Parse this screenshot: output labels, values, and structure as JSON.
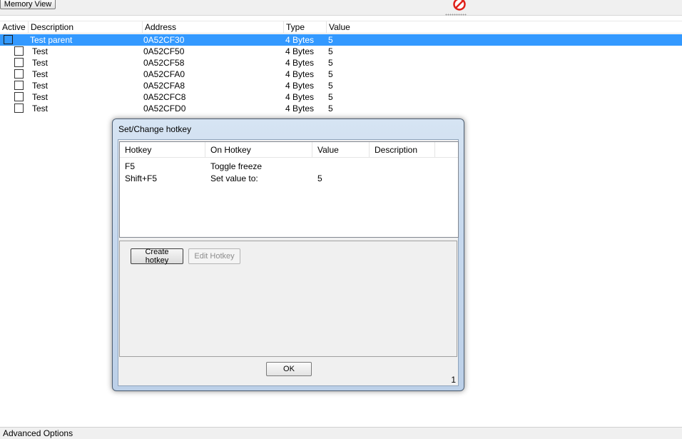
{
  "toolbar": {
    "memory_view_label": "Memory View",
    "noentry_icon": "no-entry-icon",
    "noentry_color": "#e0201a"
  },
  "address_list": {
    "columns": [
      "Active",
      "Description",
      "Address",
      "Type",
      "Value"
    ],
    "selected_color": "#3399ff",
    "rows": [
      {
        "description": "Test parent",
        "address": "0A52CF30",
        "type": "4 Bytes",
        "value": "5"
      },
      {
        "description": "Test",
        "address": "0A52CF50",
        "type": "4 Bytes",
        "value": "5"
      },
      {
        "description": "Test",
        "address": "0A52CF58",
        "type": "4 Bytes",
        "value": "5"
      },
      {
        "description": "Test",
        "address": "0A52CFA0",
        "type": "4 Bytes",
        "value": "5"
      },
      {
        "description": "Test",
        "address": "0A52CFA8",
        "type": "4 Bytes",
        "value": "5"
      },
      {
        "description": "Test",
        "address": "0A52CFC8",
        "type": "4 Bytes",
        "value": "5"
      },
      {
        "description": "Test",
        "address": "0A52CFD0",
        "type": "4 Bytes",
        "value": "5"
      }
    ]
  },
  "dialog": {
    "title": "Set/Change hotkey",
    "columns": [
      "Hotkey",
      "On Hotkey",
      "Value",
      "Description"
    ],
    "hotkeys": [
      {
        "hotkey": "F5",
        "on_hotkey": "Toggle freeze",
        "value": "",
        "description": ""
      },
      {
        "hotkey": "Shift+F5",
        "on_hotkey": "Set value to:",
        "value": "5",
        "description": ""
      }
    ],
    "create_label": "Create hotkey",
    "edit_label": "Edit Hotkey",
    "ok_label": "OK",
    "page_number": "1"
  },
  "bottom": {
    "advanced_options_label": "Advanced Options"
  }
}
